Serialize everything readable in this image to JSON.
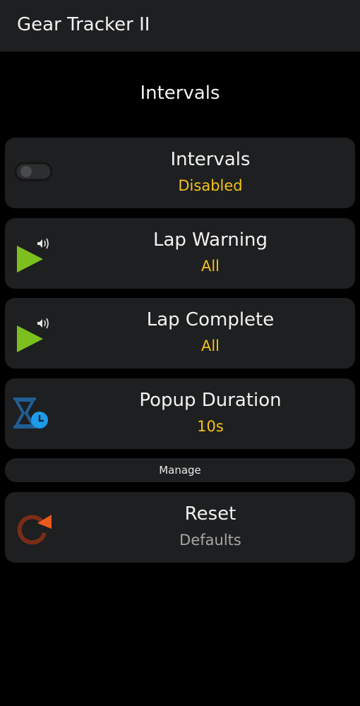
{
  "app": {
    "title": "Gear Tracker II"
  },
  "page": {
    "section_title": "Intervals"
  },
  "cards": [
    {
      "name": "intervals",
      "primary": "Intervals",
      "secondary": "Disabled",
      "icon": "toggle-off-icon"
    },
    {
      "name": "lap-warning",
      "primary": "Lap Warning",
      "secondary": "All",
      "icon": "play-sound-icon"
    },
    {
      "name": "lap-complete",
      "primary": "Lap Complete",
      "secondary": "All",
      "icon": "play-sound-icon"
    },
    {
      "name": "popup-duration",
      "primary": "Popup Duration",
      "secondary": "10s",
      "icon": "hourglass-clock-icon"
    },
    {
      "name": "reset",
      "primary": "Reset",
      "secondary": "Defaults",
      "icon": "reset-icon"
    }
  ],
  "manage": {
    "label": "Manage"
  },
  "colors": {
    "background": "#000000",
    "card": "#1e1f20",
    "accent_yellow": "#f3c315",
    "play_green": "#7cbf1e",
    "hourglass_blue": "#1f5f95",
    "clock_blue": "#1e9be8",
    "reset_orange": "#ea5a1f",
    "reset_dark": "#7a2d17",
    "muted_text": "#a7a7a7"
  }
}
